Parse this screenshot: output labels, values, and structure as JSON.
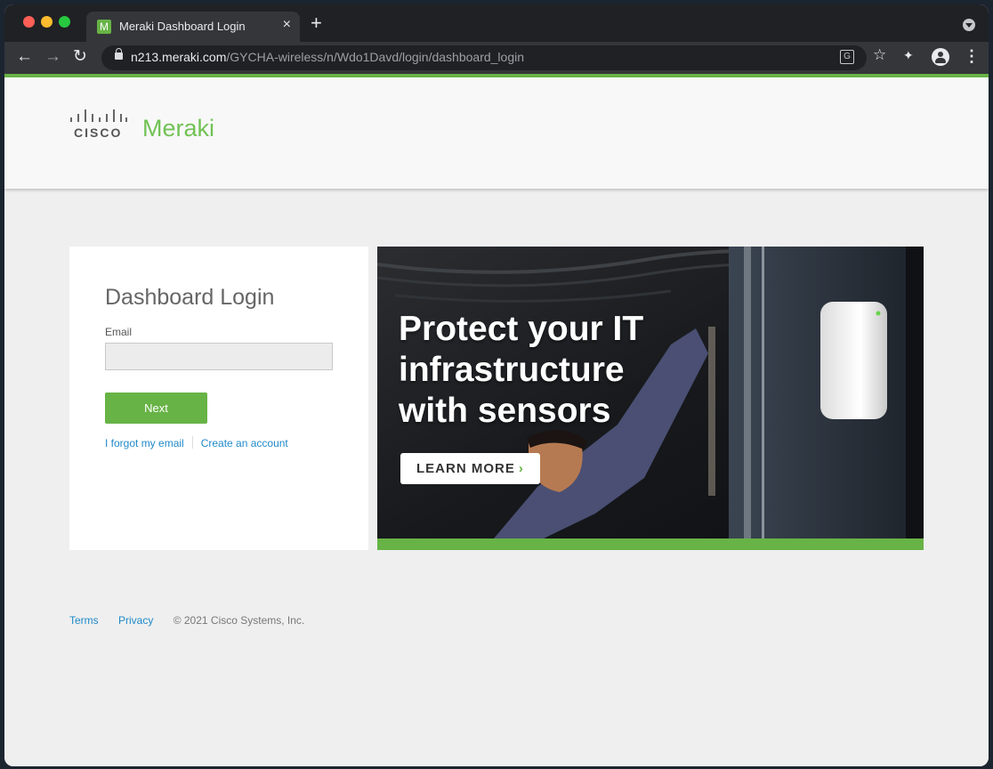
{
  "browser": {
    "tab_title": "Meraki Dashboard Login",
    "tab_favicon": "M",
    "close_glyph": "×",
    "new_tab_glyph": "+",
    "url_host": "n213.meraki.com",
    "url_path": "/GYCHA-wireless/n/Wdo1Davd/login/dashboard_login"
  },
  "header": {
    "brand_text": "CISCO",
    "product": "Meraki"
  },
  "login": {
    "title": "Dashboard Login",
    "email_label": "Email",
    "email_value": "",
    "next_label": "Next",
    "forgot_label": "I forgot my email",
    "create_label": "Create an account"
  },
  "promo": {
    "heading": "Protect your IT infrastructure with sensors",
    "cta_label": "LEARN MORE",
    "cta_chevron": "›"
  },
  "footer": {
    "terms": "Terms",
    "privacy": "Privacy",
    "copyright": "© 2021 Cisco Systems, Inc."
  },
  "colors": {
    "brand_green": "#67b346",
    "link_blue": "#1f89c9"
  }
}
